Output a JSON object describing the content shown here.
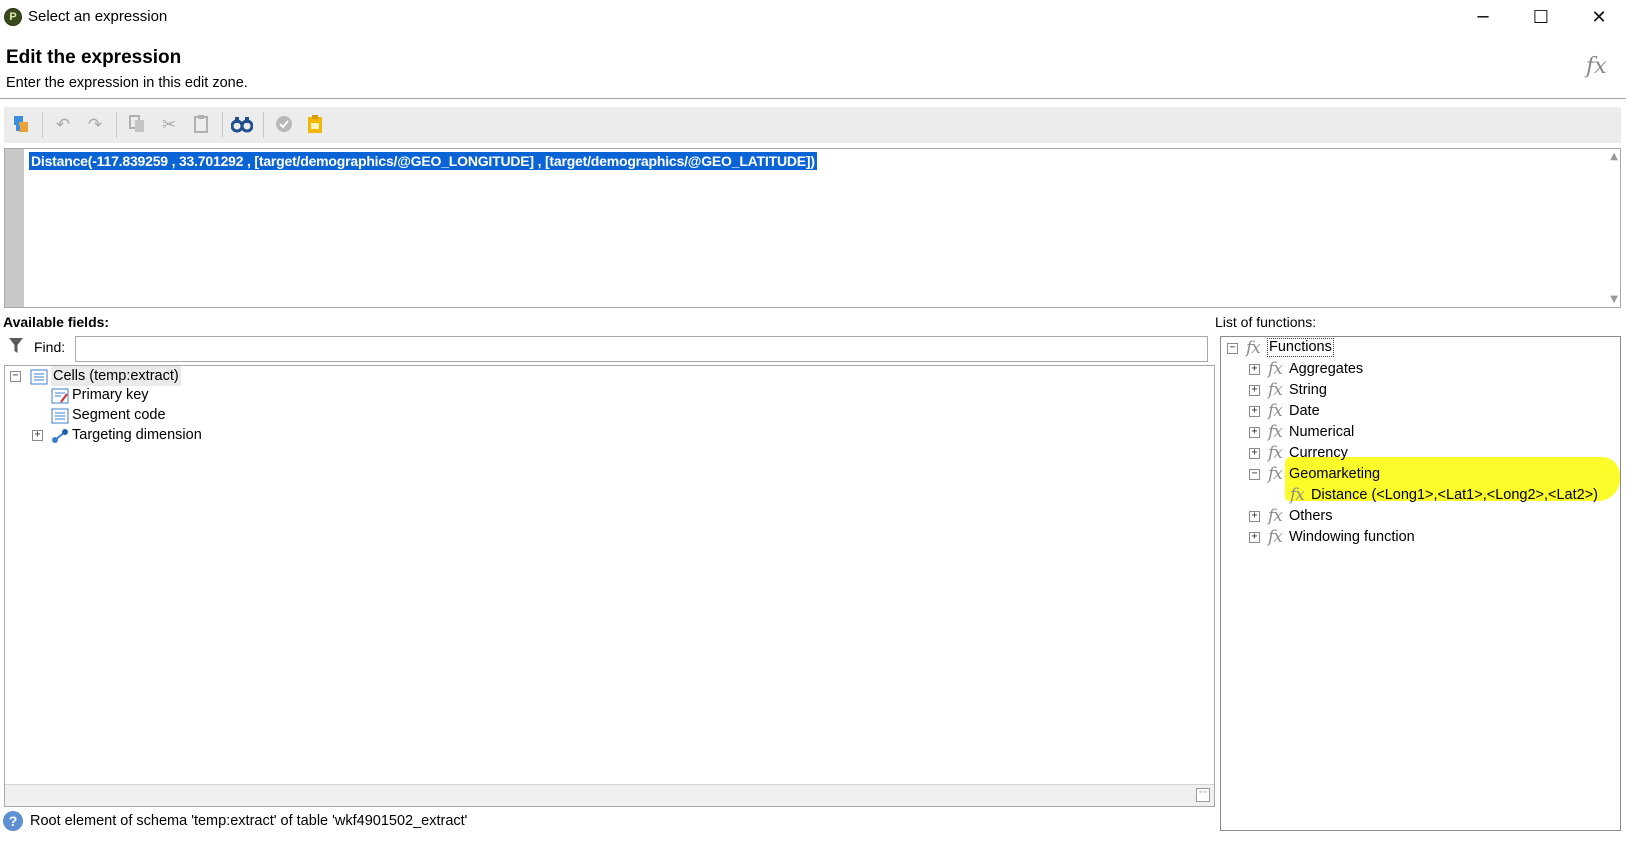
{
  "window": {
    "title": "Select an expression",
    "icon": "app-logo-icon",
    "controls": {
      "minimize": "─",
      "maximize": "☐",
      "close": "✕"
    }
  },
  "header": {
    "title": "Edit the expression",
    "subtitle": "Enter the expression in this edit zone.",
    "icon": "fx"
  },
  "toolbar": {
    "buttons": [
      "schema-icon",
      "undo-icon",
      "redo-icon",
      "copy-icon",
      "cut-icon",
      "paste-icon",
      "search-binoculars-icon",
      "validate-icon",
      "clipboard-icon"
    ]
  },
  "editor": {
    "expression": "Distance(-117.839259 , 33.701292 , [target/demographics/@GEO_LONGITUDE] , [target/demographics/@GEO_LATITUDE])"
  },
  "fields": {
    "label": "Available fields:",
    "find_label": "Find:",
    "find_value": "",
    "tree": {
      "root": {
        "label": "Cells (temp:extract)",
        "expanded": true,
        "toggle": "−"
      },
      "children": [
        {
          "label": "Primary key",
          "icon": "primary-key-icon"
        },
        {
          "label": "Segment code",
          "icon": "field-list-icon"
        },
        {
          "label": "Targeting dimension",
          "icon": "link-icon",
          "toggle": "+"
        }
      ]
    }
  },
  "functions": {
    "label": "List of functions:",
    "root": {
      "label": "Functions",
      "toggle": "−",
      "fx": "fx"
    },
    "categories": [
      {
        "label": "Aggregates",
        "toggle": "+",
        "fx": "fx"
      },
      {
        "label": "String",
        "toggle": "+",
        "fx": "fx"
      },
      {
        "label": "Date",
        "toggle": "+",
        "fx": "fx"
      },
      {
        "label": "Numerical",
        "toggle": "+",
        "fx": "fx"
      },
      {
        "label": "Currency",
        "toggle": "+",
        "fx": "fx"
      },
      {
        "label": "Geomarketing",
        "toggle": "−",
        "fx": "fx",
        "children": [
          {
            "label": "Distance (<Long1>,<Lat1>,<Long2>,<Lat2>)",
            "fx": "fx"
          }
        ]
      },
      {
        "label": "Others",
        "toggle": "+",
        "fx": "fx"
      },
      {
        "label": "Windowing function",
        "toggle": "+",
        "fx": "fx"
      }
    ],
    "highlight_color": "#fcfc2a"
  },
  "status": {
    "icon": "?",
    "text": "Root element of schema 'temp:extract' of table 'wkf4901502_extract'"
  }
}
